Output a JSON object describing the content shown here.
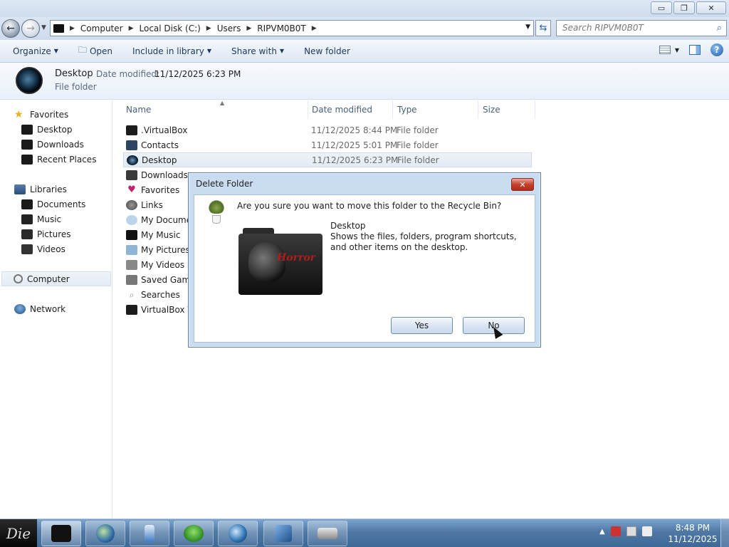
{
  "window": {
    "minimize": "▭",
    "restore": "❐",
    "close": "✕"
  },
  "address": {
    "crumbs": [
      "Computer",
      "Local Disk (C:)",
      "Users",
      "RIPVM0B0T"
    ],
    "search_placeholder": "Search RIPVM0B0T"
  },
  "toolbar": {
    "organize": "Organize",
    "open": "Open",
    "include": "Include in library",
    "share": "Share with",
    "newfolder": "New folder"
  },
  "details": {
    "name": "Desktop",
    "date_label": "Date modified:",
    "date_value": "11/12/2025 6:23 PM",
    "type": "File folder"
  },
  "nav": {
    "favorites": "Favorites",
    "fav_items": [
      "Desktop",
      "Downloads",
      "Recent Places"
    ],
    "libraries": "Libraries",
    "lib_items": [
      "Documents",
      "Music",
      "Pictures",
      "Videos"
    ],
    "computer": "Computer",
    "network": "Network"
  },
  "columns": {
    "name": "Name",
    "date": "Date modified",
    "type": "Type",
    "size": "Size"
  },
  "files": [
    {
      "name": ".VirtualBox",
      "date": "11/12/2025 8:44 PM",
      "type": "File folder",
      "icon": "folder-icon"
    },
    {
      "name": "Contacts",
      "date": "11/12/2025 5:01 PM",
      "type": "File folder",
      "icon": "contacts-icon"
    },
    {
      "name": "Desktop",
      "date": "11/12/2025 6:23 PM",
      "type": "File folder",
      "icon": "desktop-icon"
    },
    {
      "name": "Downloads",
      "date": "",
      "type": "",
      "icon": "downloads-icon"
    },
    {
      "name": "Favorites",
      "date": "",
      "type": "",
      "icon": "favorites-icon"
    },
    {
      "name": "Links",
      "date": "",
      "type": "",
      "icon": "links-icon"
    },
    {
      "name": "My Docume",
      "date": "",
      "type": "",
      "icon": "documents-icon"
    },
    {
      "name": "My Music",
      "date": "",
      "type": "",
      "icon": "music-icon"
    },
    {
      "name": "My Pictures",
      "date": "",
      "type": "",
      "icon": "pictures-icon"
    },
    {
      "name": "My Videos",
      "date": "",
      "type": "",
      "icon": "videos-icon"
    },
    {
      "name": "Saved Game",
      "date": "",
      "type": "",
      "icon": "saved-games-icon"
    },
    {
      "name": "Searches",
      "date": "",
      "type": "",
      "icon": "searches-icon"
    },
    {
      "name": "VirtualBox VI",
      "date": "",
      "type": "",
      "icon": "folder-icon"
    }
  ],
  "dialog": {
    "title": "Delete Folder",
    "question": "Are you sure you want to move this folder to the Recycle Bin?",
    "folder_name": "Desktop",
    "folder_desc": "Shows the files, folders, program shortcuts, and other items on the desktop.",
    "folder_art_text": "Horror",
    "yes": "Yes",
    "no": "No",
    "close": "✕"
  },
  "taskbar": {
    "start_logo_text": "Die",
    "clock_time": "8:48 PM",
    "clock_date": "11/12/2025"
  }
}
